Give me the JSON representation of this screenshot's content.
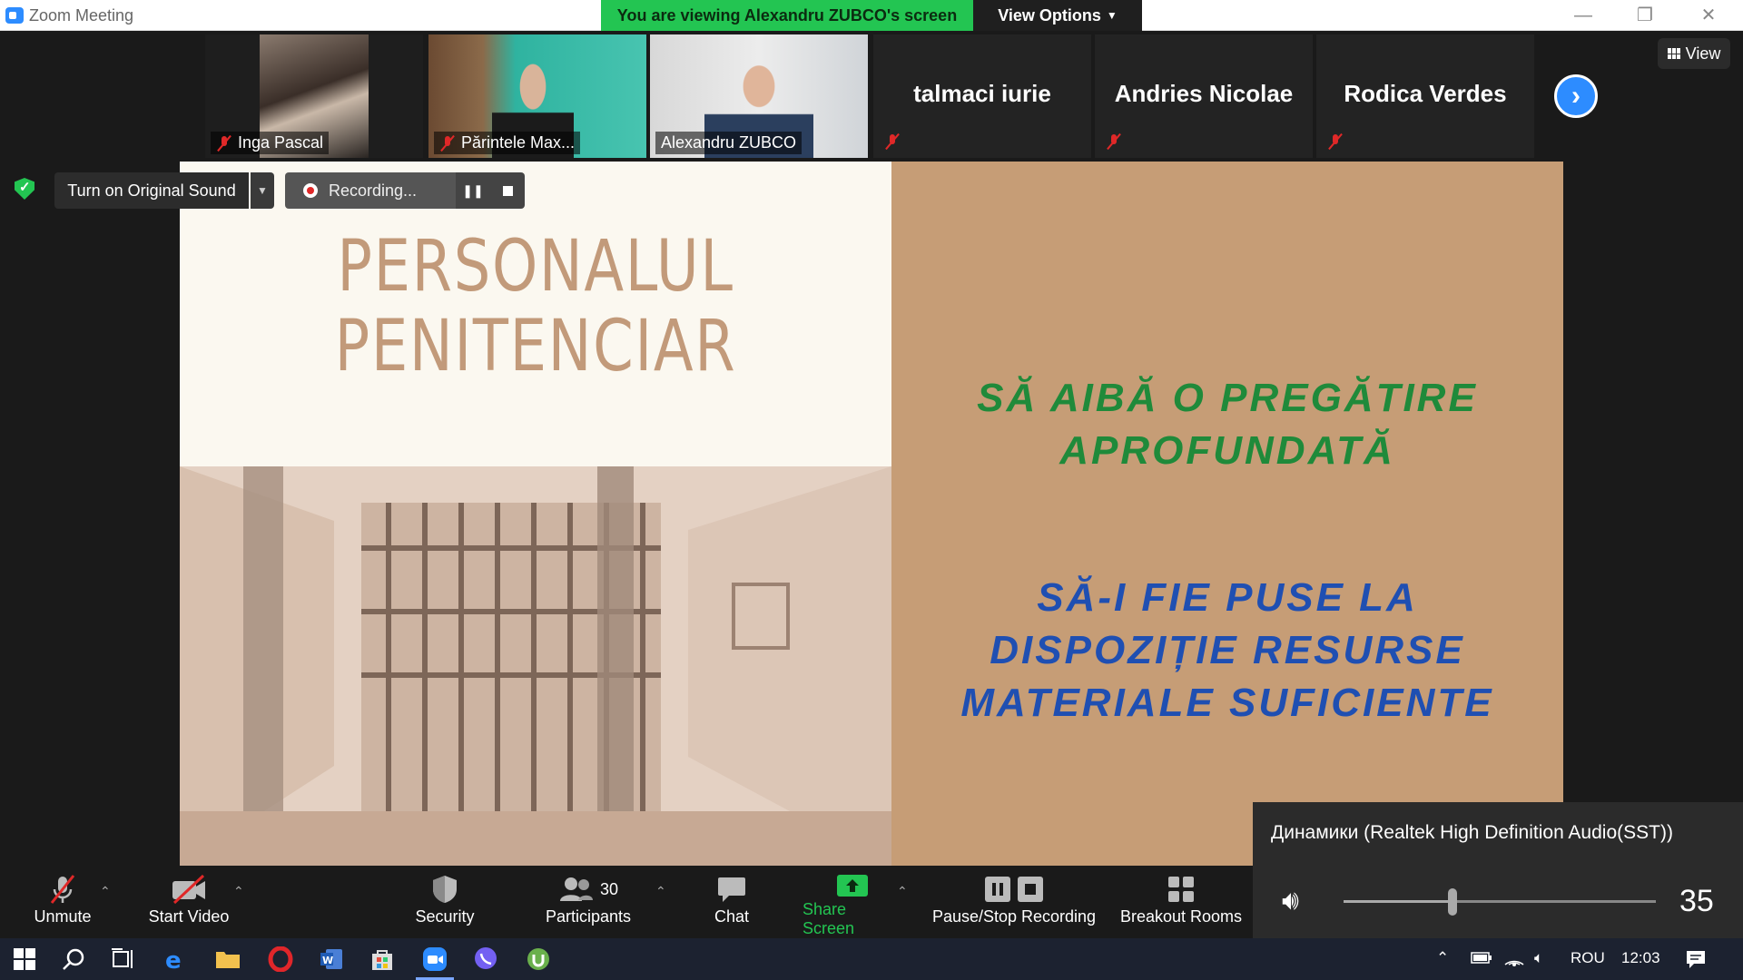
{
  "window": {
    "title": "Zoom Meeting",
    "viewing_banner": "You are viewing Alexandru ZUBCO's screen",
    "view_options_label": "View Options",
    "minimize_glyph": "—",
    "restore_glyph": "❐",
    "close_glyph": "✕"
  },
  "strip": {
    "participants": [
      {
        "name": "Inga Pascal",
        "muted": true,
        "video": true
      },
      {
        "name": "Părintele Max...",
        "muted": true,
        "video": true
      },
      {
        "name": "Alexandru ZUBCO",
        "muted": false,
        "video": true,
        "active": true
      },
      {
        "name": "talmaci iurie",
        "muted": true,
        "video": false
      },
      {
        "name": "Andries Nicolae",
        "muted": true,
        "video": false
      },
      {
        "name": "Rodica Verdes",
        "muted": true,
        "video": false
      }
    ],
    "next_icon": "chevron-right-icon",
    "view_label": "View"
  },
  "controls": {
    "original_sound_label": "Turn on Original Sound",
    "recording_label": "Recording..."
  },
  "slide": {
    "title_line1": "PERSONALUL",
    "title_line2": "PENITENCIAR",
    "green_line1": "SĂ AIBĂ O PREGĂTIRE",
    "green_line2": "APROFUNDATĂ",
    "blue_line1": "SĂ-I FIE PUSE LA",
    "blue_line2": "DISPOZIȚIE RESURSE",
    "blue_line3": "MATERIALE SUFICIENTE"
  },
  "toolbar": {
    "unmute_label": "Unmute",
    "start_video_label": "Start Video",
    "security_label": "Security",
    "participants_label": "Participants",
    "participants_count": "30",
    "chat_label": "Chat",
    "share_screen_label": "Share Screen",
    "pause_stop_recording_label": "Pause/Stop Recording",
    "breakout_rooms_label": "Breakout Rooms"
  },
  "volume_popup": {
    "device_name": "Динамики (Realtek High Definition Audio(SST))",
    "level": 35
  },
  "taskbar": {
    "language": "ROU",
    "clock": "12:03"
  },
  "colors": {
    "zoom_blue": "#2d8cff",
    "banner_green": "#23c552",
    "slide_tan": "#c69d76",
    "slide_green_text": "#1f8a3a",
    "slide_blue_text": "#1f4fb2",
    "muted_red": "#e02828"
  }
}
